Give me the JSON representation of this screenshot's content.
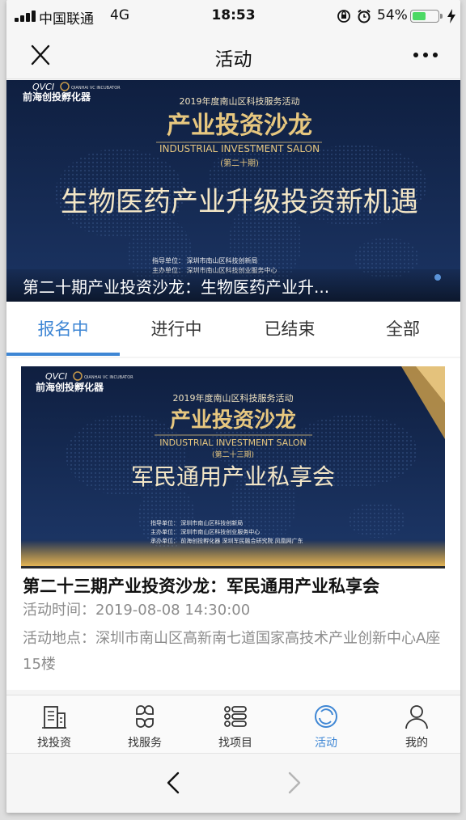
{
  "status_bar": {
    "carrier": "中国联通",
    "network": "4G",
    "time": "18:53",
    "battery_percent": "54%",
    "battery_level": 0.54
  },
  "nav": {
    "title": "活动",
    "close_icon": "close-icon",
    "more_icon": "more-icon"
  },
  "banner": {
    "logo_brand": "QVCI",
    "logo_en": "QIANHAI VC INCUBATOR",
    "logo_cn": "前海创投孵化器",
    "event_series_title": "2019年度南山区科技服务活动",
    "salon_title": "产业投资沙龙",
    "salon_en": "INDUSTRIAL INVESTMENT SALON",
    "session": "(第二十期)",
    "topic": "生物医药产业升级投资新机遇",
    "organizers": [
      "指导单位：  深圳市南山区科技创新局",
      "主办单位：  深圳市南山区科技创业服务中心"
    ],
    "caption": "第二十期产业投资沙龙：生物医药产业升..."
  },
  "tabs": [
    {
      "label": "报名中",
      "active": true
    },
    {
      "label": "进行中",
      "active": false
    },
    {
      "label": "已结束",
      "active": false
    },
    {
      "label": "全部",
      "active": false
    }
  ],
  "card": {
    "image": {
      "logo_brand": "QVCI",
      "logo_en": "QIANHAI VC INCUBATOR",
      "logo_cn": "前海创投孵化器",
      "event_series_title": "2019年度南山区科技服务活动",
      "salon_title": "产业投资沙龙",
      "salon_en": "INDUSTRIAL INVESTMENT SALON",
      "session": "(第二十三期)",
      "topic": "军民通用产业私享会",
      "organizers": [
        "指导单位：  深圳市南山区科技创新局",
        "主办单位：  深圳市南山区科技创业服务中心",
        "承办单位：  前海创投孵化器   深圳军民融合研究院   凤凰网广东"
      ]
    },
    "title": "第二十三期产业投资沙龙：军民通用产业私享会",
    "time_label": "活动时间：",
    "time_value": "2019-08-08 14:30:00",
    "location_label": "活动地点：",
    "location_value": "深圳市南山区高新南七道国家高技术产业创新中心A座15楼"
  },
  "tabbar": [
    {
      "label": "找投资",
      "icon": "building-icon",
      "active": false
    },
    {
      "label": "找服务",
      "icon": "grid-icon",
      "active": false
    },
    {
      "label": "找项目",
      "icon": "list-icon",
      "active": false
    },
    {
      "label": "活动",
      "icon": "activity-icon",
      "active": true
    },
    {
      "label": "我的",
      "icon": "user-icon",
      "active": false
    }
  ],
  "colors": {
    "accent": "#3e86d4",
    "banner_bg": "#14264a",
    "gold": "#d9b46a"
  }
}
